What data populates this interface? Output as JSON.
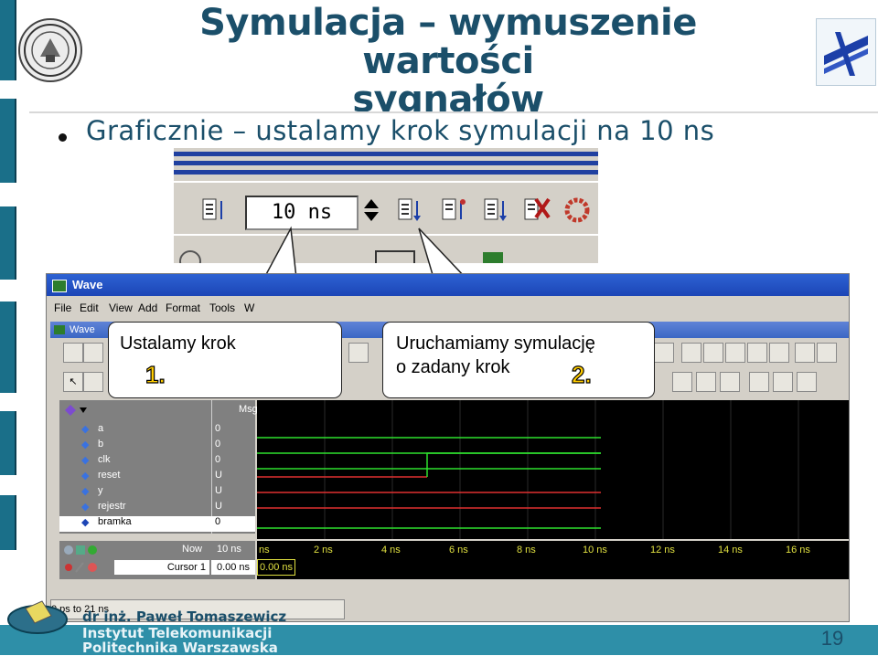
{
  "slide": {
    "title_line1": "Symulacja – wymuszenie wartości",
    "title_line2": "sygnałów",
    "bullet": "Graficznie – ustalamy krok symulacji na 10 ns",
    "footer_author": "dr inż. Paweł Tomaszewicz",
    "footer_institute": "Instytut Telekomunikacji",
    "footer_university": "Politechnika Warszawska",
    "page_number": "19",
    "colors": {
      "accent": "#1b4f6a",
      "footer": "#2e8fa8"
    }
  },
  "zoom_toolbar": {
    "step_value": "10 ns",
    "icons": [
      "run-length-icon",
      "spin-up-icon",
      "run-icon",
      "continue-icon",
      "run-all-icon",
      "break-icon",
      "restart-icon"
    ]
  },
  "wave_window": {
    "title": "Wave",
    "subtitle": "Wave",
    "menu": [
      "File",
      "Edit",
      "View",
      "Add",
      "Format",
      "Tools",
      "W"
    ],
    "msgs_header": "Msgs",
    "signals": [
      {
        "name": "a",
        "value": "0"
      },
      {
        "name": "b",
        "value": "0"
      },
      {
        "name": "clk",
        "value": "0"
      },
      {
        "name": "reset",
        "value": "U"
      },
      {
        "name": "y",
        "value": "U"
      },
      {
        "name": "rejestr",
        "value": "U"
      },
      {
        "name": "bramka",
        "value": "0"
      }
    ],
    "now_label": "Now",
    "now_value": "10 ns",
    "cursor_label": "Cursor 1",
    "cursor_value": "0.00 ns",
    "cursor_flag": "0.00 ns",
    "time_ticks": [
      "ns",
      "2 ns",
      "4 ns",
      "6 ns",
      "8 ns",
      "10 ns",
      "12 ns",
      "14 ns",
      "16 ns"
    ],
    "status": "0 ps to 21 ns"
  },
  "callouts": {
    "step": {
      "text": "Ustalamy krok",
      "number": "1."
    },
    "run": {
      "line1": "Uruchamiamy symulację",
      "line2": "o zadany krok",
      "number": "2."
    }
  }
}
